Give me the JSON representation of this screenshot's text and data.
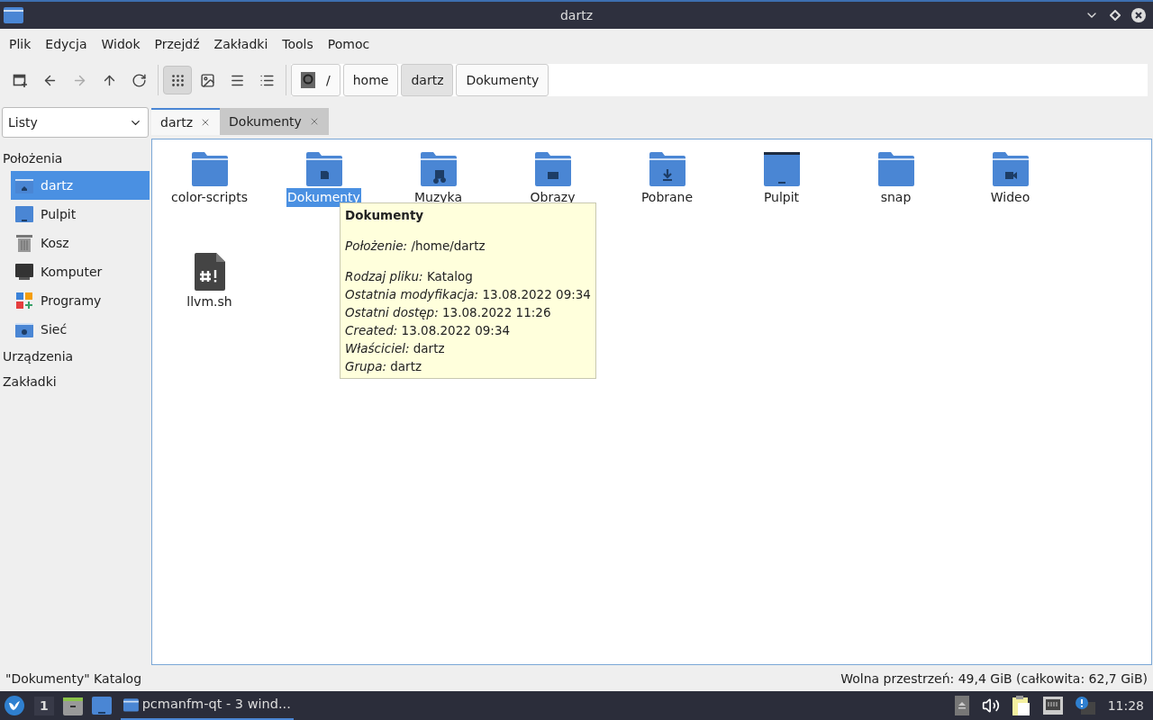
{
  "window": {
    "title": "dartz"
  },
  "menu": [
    "Plik",
    "Edycja",
    "Widok",
    "Przejdź",
    "Zakładki",
    "Tools",
    "Pomoc"
  ],
  "toolbar": {
    "nav": [
      {
        "kind": "new-window",
        "disabled": false
      },
      {
        "kind": "back",
        "disabled": false
      },
      {
        "kind": "forward",
        "disabled": true
      },
      {
        "kind": "up",
        "disabled": false
      },
      {
        "kind": "reload",
        "disabled": false
      }
    ],
    "views": [
      {
        "kind": "icons",
        "selected": true
      },
      {
        "kind": "thumbnails",
        "selected": false
      },
      {
        "kind": "compact",
        "selected": false
      },
      {
        "kind": "details",
        "selected": false
      }
    ]
  },
  "path": [
    {
      "label": "/",
      "kind": "root",
      "selected": false
    },
    {
      "label": "home",
      "kind": "dir",
      "selected": false
    },
    {
      "label": "dartz",
      "kind": "dir",
      "selected": true
    },
    {
      "label": "Dokumenty",
      "kind": "dir",
      "selected": false
    }
  ],
  "side_mode": "Listy",
  "tabs": [
    {
      "label": "dartz",
      "selected": true
    },
    {
      "label": "Dokumenty",
      "selected": false
    }
  ],
  "sidebar": {
    "sections": [
      {
        "label": "Położenia",
        "items": [
          {
            "label": "dartz",
            "kind": "home",
            "selected": true
          },
          {
            "label": "Pulpit",
            "kind": "desktop",
            "selected": false
          },
          {
            "label": "Kosz",
            "kind": "trash",
            "selected": false
          },
          {
            "label": "Komputer",
            "kind": "computer",
            "selected": false
          },
          {
            "label": "Programy",
            "kind": "apps",
            "selected": false
          },
          {
            "label": "Sieć",
            "kind": "network",
            "selected": false
          }
        ]
      },
      {
        "label": "Urządzenia"
      },
      {
        "label": "Zakładki"
      }
    ]
  },
  "files": [
    {
      "name": "color-scripts",
      "kind": "folder",
      "selected": false
    },
    {
      "name": "Dokumenty",
      "kind": "documents",
      "selected": true
    },
    {
      "name": "Muzyka",
      "kind": "music",
      "selected": false
    },
    {
      "name": "Obrazy",
      "kind": "pictures",
      "selected": false
    },
    {
      "name": "Pobrane",
      "kind": "downloads",
      "selected": false
    },
    {
      "name": "Pulpit",
      "kind": "desktop",
      "selected": false
    },
    {
      "name": "snap",
      "kind": "folder",
      "selected": false
    },
    {
      "name": "Wideo",
      "kind": "videos",
      "selected": false
    },
    {
      "name": "llvm.sh",
      "kind": "script",
      "selected": false
    }
  ],
  "tooltip": {
    "title": "Dokumenty",
    "groups": [
      [
        {
          "label": "Położenie:",
          "value": "/home/dartz"
        }
      ],
      [
        {
          "label": "Rodzaj pliku:",
          "value": "Katalog"
        },
        {
          "label": "Ostatnia modyfikacja:",
          "value": "13.08.2022 09:34"
        },
        {
          "label": "Ostatni dostęp:",
          "value": "13.08.2022 11:26"
        },
        {
          "label": "Created:",
          "value": "13.08.2022 09:34"
        },
        {
          "label": "Właściciel:",
          "value": "dartz"
        },
        {
          "label": "Grupa:",
          "value": "dartz"
        }
      ]
    ]
  },
  "status_bar": {
    "left": "\"Dokumenty\" Katalog",
    "right": "Wolna przestrzeń: 49,4 GiB (całkowita: 62,7 GiB)"
  },
  "taskbar": {
    "desktop": "1",
    "task": "pcmanfm-qt - 3 wind...",
    "clock": "11:28"
  }
}
